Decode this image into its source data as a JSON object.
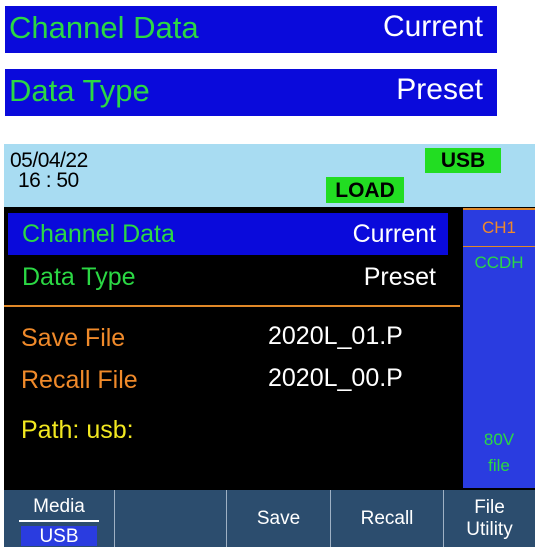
{
  "example_rows": [
    {
      "label": "Channel Data",
      "value": "Current"
    },
    {
      "label": "Data Type",
      "value": "Preset"
    }
  ],
  "status": {
    "date": "05/04/22",
    "time": "16 : 50",
    "usb": "USB",
    "load": "LOAD"
  },
  "menu": {
    "channel_data_label": "Channel Data",
    "channel_data_value": "Current",
    "data_type_label": "Data Type",
    "data_type_value": "Preset",
    "save_file_label": "Save File",
    "save_file_value": "2020L_01.P",
    "recall_file_label": "Recall File",
    "recall_file_value": "2020L_00.P",
    "path_label": "Path:  usb:"
  },
  "side_panel": {
    "channel": "CH1",
    "mode": "CCDH",
    "range": "80V",
    "type": "file"
  },
  "softkeys": {
    "media_label": "Media",
    "media_value": "USB",
    "empty": "",
    "save": "Save",
    "recall": "Recall",
    "file_line1": "File",
    "file_line2": "Utility"
  },
  "colors": {
    "selected_bg": "#0a0adb",
    "green": "#2bd844",
    "orange": "#f08a2a",
    "yellow": "#f2e820",
    "status_bg": "#a8dcf2"
  }
}
